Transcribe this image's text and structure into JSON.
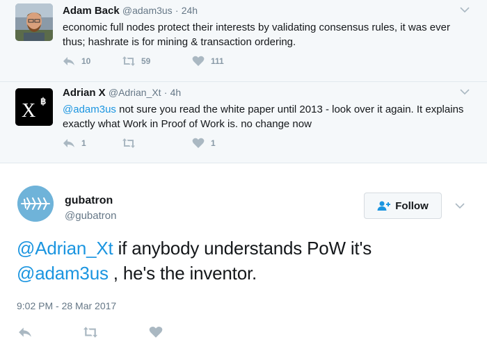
{
  "tweets": [
    {
      "display_name": "Adam Back",
      "handle": "@adam3us",
      "separator": "·",
      "time": "24h",
      "text": "economic full nodes protect their interests by validating consensus rules, it was ever thus; hashrate is for mining & transaction ordering.",
      "reply_count": "10",
      "retweet_count": "59",
      "like_count": "111"
    },
    {
      "display_name": "Adrian X",
      "handle": "@Adrian_Xt",
      "separator": "·",
      "time": "4h",
      "mention": "@adam3us",
      "text": " not sure you read the white paper until 2013 - look over it again. It explains exactly what Work in Proof of Work is. no change now",
      "reply_count": "1",
      "retweet_count": "",
      "like_count": "1",
      "avatar_text": "X",
      "avatar_superscript": "฿"
    }
  ],
  "main": {
    "display_name": "gubatron",
    "handle": "@gubatron",
    "follow_label": "Follow",
    "text_mention1": "@Adrian_Xt",
    "text_part1": " if anybody understands PoW it's ",
    "text_mention2": "@adam3us",
    "text_part2": " , he's the inventor.",
    "timestamp": "9:02 PM - 28 Mar 2017"
  },
  "colors": {
    "link": "#1b95e0",
    "icon": "#aab8c2",
    "parent_bg": "#f5f8fa"
  },
  "icons": [
    "chevron-down-icon",
    "reply-icon",
    "retweet-icon",
    "heart-icon",
    "follow-person-icon"
  ]
}
